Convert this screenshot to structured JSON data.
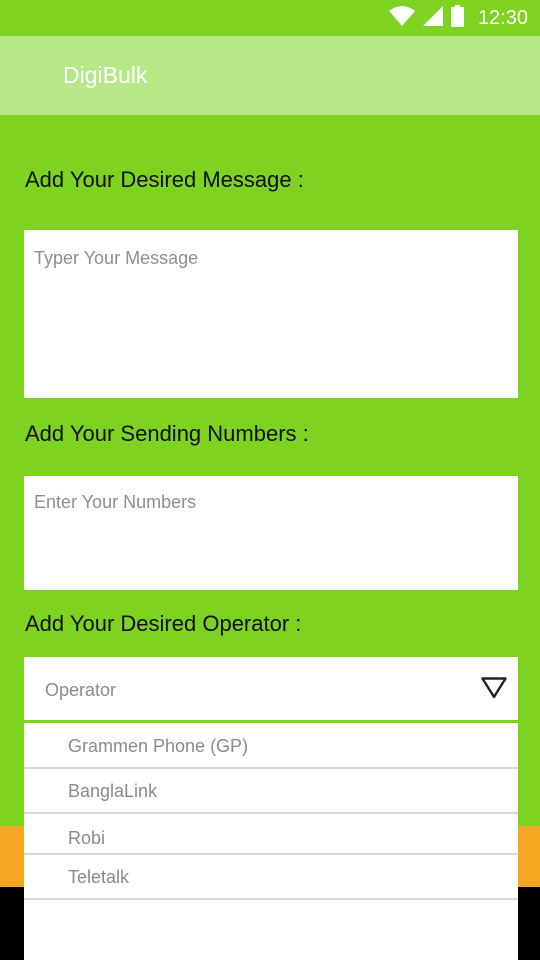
{
  "status_bar": {
    "time": "12:30",
    "icons": [
      "wifi-icon",
      "cellular-signal-icon",
      "battery-icon"
    ]
  },
  "app_bar": {
    "title": "DigiBulk"
  },
  "message": {
    "label": "Add Your Desired Message :",
    "placeholder": "Typer Your Message",
    "value": ""
  },
  "numbers": {
    "label": "Add Your Sending Numbers :",
    "placeholder": "Enter Your Numbers",
    "value": ""
  },
  "operator": {
    "label": "Add Your Desired Operator :",
    "selected": "Operator",
    "options": [
      "Grammen Phone (GP)",
      "BanglaLink",
      "Robi",
      "Teletalk"
    ]
  },
  "colors": {
    "background": "#7ed321",
    "app_bar": "#b6e887",
    "orange_band": "#f5a623",
    "accent": "#7ed321"
  }
}
